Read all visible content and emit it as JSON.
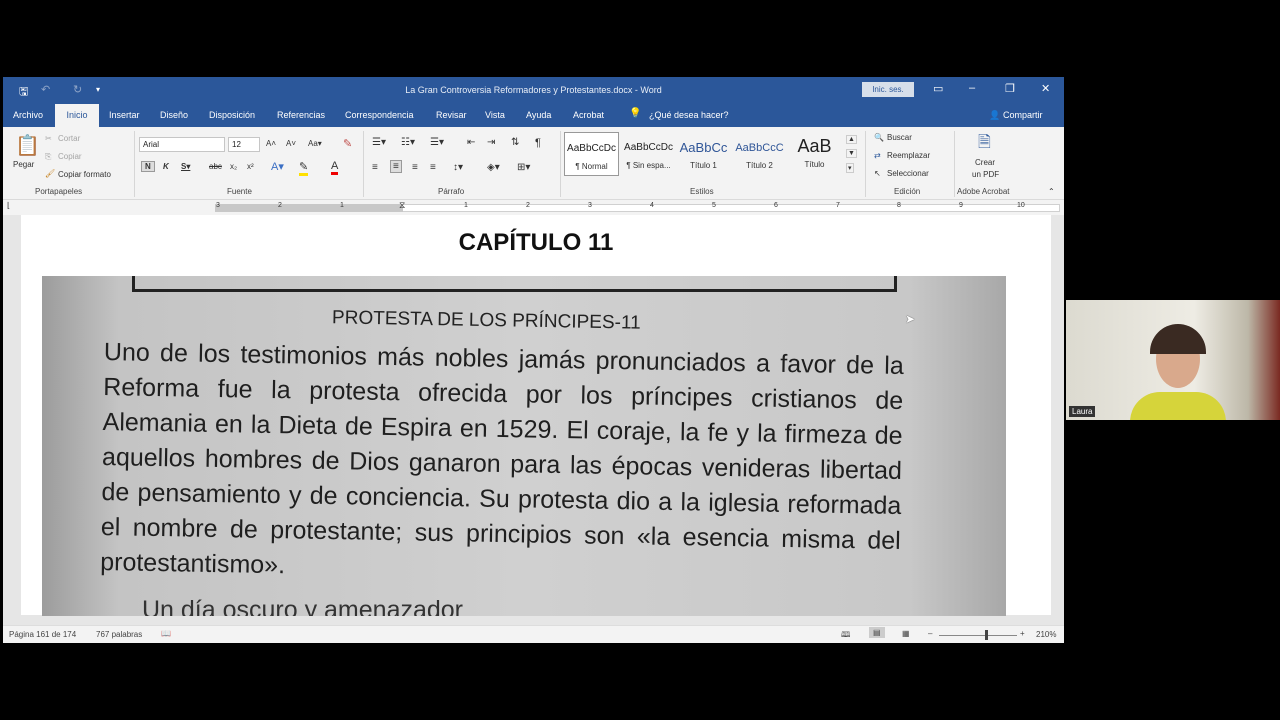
{
  "window": {
    "title": "La Gran Controversia Reformadores y Protestantes.docx  -  Word",
    "signin": "Inic. ses."
  },
  "menu": {
    "tabs": [
      "Archivo",
      "Inicio",
      "Insertar",
      "Diseño",
      "Disposición",
      "Referencias",
      "Correspondencia",
      "Revisar",
      "Vista",
      "Ayuda",
      "Acrobat"
    ],
    "tell_me": "¿Qué desea hacer?",
    "share": "Compartir"
  },
  "ribbon": {
    "clipboard": {
      "paste": "Pegar",
      "cut": "Cortar",
      "copy": "Copiar",
      "format_painter": "Copiar formato",
      "label": "Portapapeles"
    },
    "font": {
      "name": "Arial",
      "size": "12",
      "label": "Fuente"
    },
    "paragraph": {
      "label": "Párrafo"
    },
    "styles": {
      "label": "Estilos",
      "items": [
        {
          "preview": "AaBbCcDc",
          "name": "¶ Normal"
        },
        {
          "preview": "AaBbCcDc",
          "name": "¶ Sin espa..."
        },
        {
          "preview": "AaBbCc",
          "name": "Título 1"
        },
        {
          "preview": "AaBbCcC",
          "name": "Título 2"
        },
        {
          "preview": "AaB",
          "name": "Título"
        }
      ]
    },
    "editing": {
      "find": "Buscar",
      "replace": "Reemplazar",
      "select": "Seleccionar",
      "label": "Edición"
    },
    "acrobat": {
      "create": "Crear",
      "pdf": "un PDF",
      "label": "Adobe Acrobat"
    }
  },
  "ruler": {
    "numbers": [
      "3",
      "2",
      "1",
      "1",
      "1",
      "2",
      "3",
      "4",
      "5",
      "6",
      "7",
      "8",
      "9",
      "10"
    ]
  },
  "document": {
    "chapter_title": "CAPÍTULO 11",
    "photo_heading": "PROTESTA DE LOS PRÍNCIPES-11",
    "photo_paragraph": "Uno de los testimonios más nobles jamás pronunciados a favor de la Reforma fue la protesta ofrecida por los príncipes cristianos de Alemania en la Dieta de Espira en 1529. El coraje, la fe y la firmeza de aquellos hombres de Dios ganaron para las épocas venideras libertad de pensamiento y de conciencia. Su protesta dio a la iglesia reformada el nombre de protestante; sus principios son «la esencia misma del protestantismo».",
    "photo_next_line": "Un día oscuro y amenazador"
  },
  "status": {
    "page": "Página 161 de 174",
    "words": "767 palabras",
    "zoom": "210%"
  },
  "webcam": {
    "name": "Laura"
  },
  "colors": {
    "accent": "#2b579a"
  }
}
